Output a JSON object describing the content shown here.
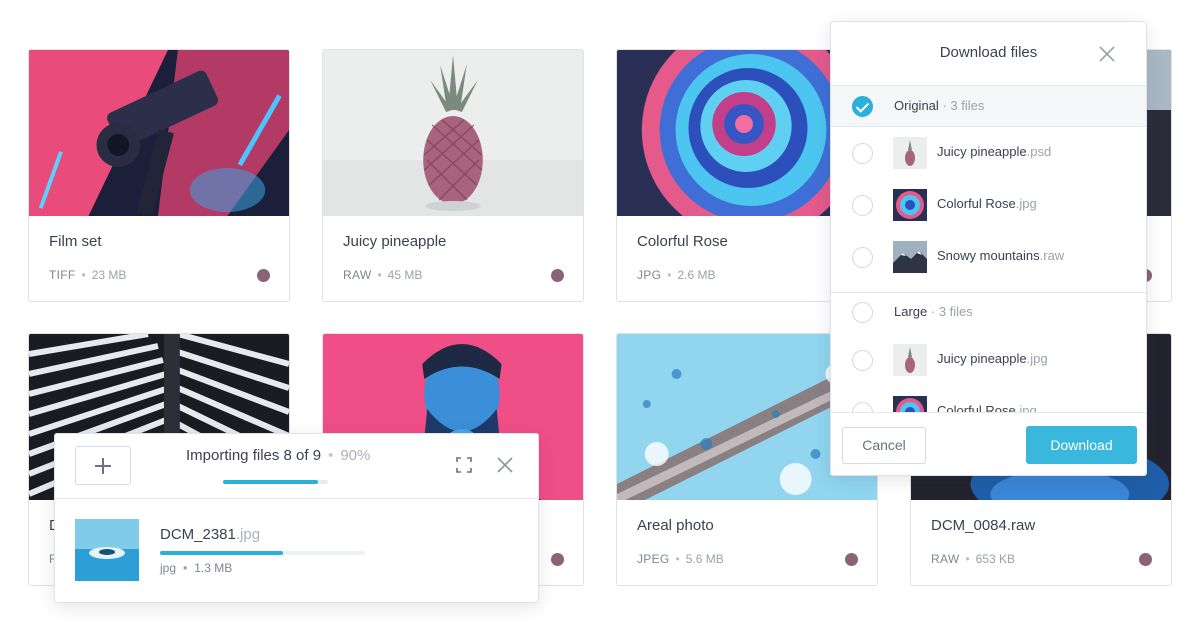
{
  "cards": [
    {
      "title": "Film set",
      "format": "TIFF",
      "size": "23 MB",
      "thumb": "film-set"
    },
    {
      "title": "Juicy pineapple",
      "format": "RAW",
      "size": "45 MB",
      "thumb": "pineapple"
    },
    {
      "title": "Colorful Rose",
      "format": "JPG",
      "size": "2.6 MB",
      "thumb": "rose"
    },
    {
      "title": "Snowy mountains",
      "format": "",
      "size": "",
      "thumb": "mountains"
    },
    {
      "title": "D",
      "format": "F",
      "size": "",
      "thumb": "building"
    },
    {
      "title": "",
      "format": "",
      "size": "",
      "thumb": "portrait"
    },
    {
      "title": "Areal photo",
      "format": "JPEG",
      "size": "5.6 MB",
      "thumb": "areal"
    },
    {
      "title": "DCM_0084.raw",
      "format": "RAW",
      "size": "653 KB",
      "thumb": "dark-blue"
    }
  ],
  "card_dot_color": "#8a6476",
  "import_panel": {
    "status": "Importing files 8 of 9",
    "percent_label": "90%",
    "progress": 0.9,
    "file": {
      "name": "DCM_2381",
      "ext": ".jpg",
      "type": "jpg",
      "size": "1.3 MB",
      "progress": 0.6
    },
    "add_icon": "plus-icon",
    "expand_icon": "expand-icon",
    "close_icon": "close-icon"
  },
  "download_panel": {
    "title": "Download files",
    "groups": [
      {
        "label": "Original",
        "count": "3 files",
        "checked": true,
        "files": [
          {
            "name": "Juicy pineapple",
            "ext": ".psd",
            "thumb": "pineapple"
          },
          {
            "name": "Colorful Rose",
            "ext": ".jpg",
            "thumb": "rose"
          },
          {
            "name": "Snowy mountains",
            "ext": ".raw",
            "thumb": "mountains"
          }
        ]
      },
      {
        "label": "Large",
        "count": "3 files",
        "checked": false,
        "files": [
          {
            "name": "Juicy pineapple",
            "ext": ".jpg",
            "thumb": "pineapple"
          },
          {
            "name": "Colorful Rose",
            "ext": ".jpg",
            "thumb": "rose"
          }
        ]
      }
    ],
    "cancel_label": "Cancel",
    "download_label": "Download"
  },
  "colors": {
    "accent": "#2ab0d9",
    "text": "#3a4150",
    "muted": "#9aa2ad"
  }
}
